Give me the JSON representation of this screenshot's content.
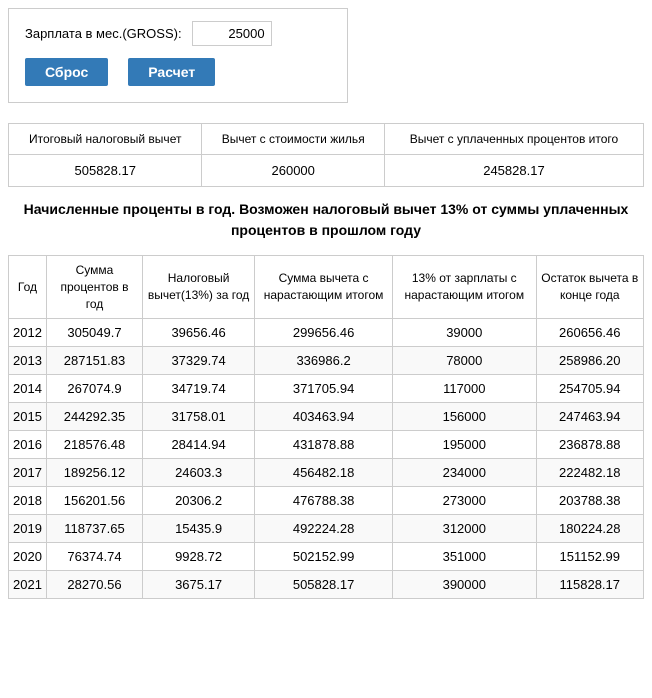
{
  "top": {
    "salary_label": "Зарплата в мес.(GROSS):",
    "salary_value": "25000",
    "reset_label": "Сброс",
    "calc_label": "Расчет"
  },
  "summary": {
    "headers": [
      "Итоговый налоговый вычет",
      "Вычет с стоимости жилья",
      "Вычет с уплаченных процентов итого"
    ],
    "values": [
      "505828.17",
      "260000",
      "245828.17"
    ]
  },
  "section_title": "Начисленные проценты в год. Возможен налоговый вычет 13% от суммы уплаченных процентов в прошлом году",
  "main_table": {
    "headers": [
      "Год",
      "Сумма процентов в год",
      "Налоговый вычет(13%) за год",
      "Сумма вычета с нарастающим итогом",
      "13% от зарплаты с нарастающим итогом",
      "Остаток вычета в конце года"
    ],
    "rows": [
      [
        "2012",
        "305049.7",
        "39656.46",
        "299656.46",
        "39000",
        "260656.46"
      ],
      [
        "2013",
        "287151.83",
        "37329.74",
        "336986.2",
        "78000",
        "258986.20"
      ],
      [
        "2014",
        "267074.9",
        "34719.74",
        "371705.94",
        "117000",
        "254705.94"
      ],
      [
        "2015",
        "244292.35",
        "31758.01",
        "403463.94",
        "156000",
        "247463.94"
      ],
      [
        "2016",
        "218576.48",
        "28414.94",
        "431878.88",
        "195000",
        "236878.88"
      ],
      [
        "2017",
        "189256.12",
        "24603.3",
        "456482.18",
        "234000",
        "222482.18"
      ],
      [
        "2018",
        "156201.56",
        "20306.2",
        "476788.38",
        "273000",
        "203788.38"
      ],
      [
        "2019",
        "118737.65",
        "15435.9",
        "492224.28",
        "312000",
        "180224.28"
      ],
      [
        "2020",
        "76374.74",
        "9928.72",
        "502152.99",
        "351000",
        "151152.99"
      ],
      [
        "2021",
        "28270.56",
        "3675.17",
        "505828.17",
        "390000",
        "115828.17"
      ]
    ]
  }
}
